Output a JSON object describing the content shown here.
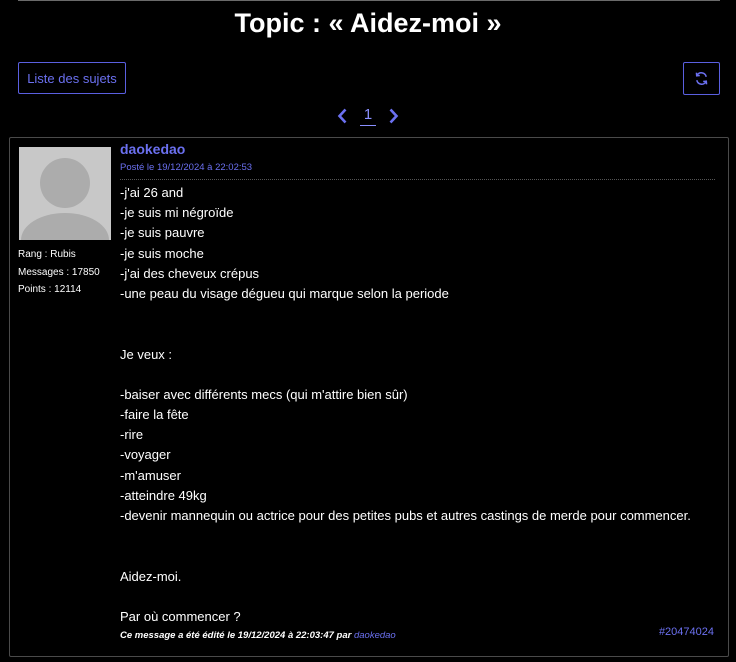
{
  "header": {
    "title": "Topic : « Aidez-moi »"
  },
  "toolbar": {
    "list_label": "Liste des sujets",
    "refresh_icon": "refresh-icon"
  },
  "pagination": {
    "current_page": "1",
    "prev_icon": "chevron-left-icon",
    "next_icon": "chevron-right-icon"
  },
  "post": {
    "author": "daokedao",
    "date": "Posté le 19/12/2024 à 22:02:53",
    "rank": "Rang : Rubis",
    "messages": "Messages : 17850",
    "points": "Points : 12114",
    "lines": [
      "-j'ai 26 and",
      "-je suis mi négroïde",
      "-je suis pauvre",
      "-je suis moche",
      "-j'ai des cheveux crépus",
      "-une peau du visage dégueu qui marque selon la periode",
      "",
      "",
      "Je veux :",
      "",
      "-baiser avec différents mecs (qui m'attire bien sûr)",
      "-faire la fête",
      "-rire",
      "-voyager",
      "-m'amuser",
      "-atteindre 49kg",
      "-devenir mannequin ou actrice pour des petites pubs et autres castings de merde pour commencer.",
      "",
      "",
      "Aidez-moi.",
      "",
      "Par où commencer ?"
    ],
    "edit_prefix": "Ce message a été édité le 19/12/2024 à 22:03:47 par ",
    "edit_author": "daokedao",
    "message_id": "#20474024"
  },
  "colors": {
    "background": "#000000",
    "accent": "#6b70f0",
    "border": "#4a4a4a",
    "text": "#ffffff"
  }
}
